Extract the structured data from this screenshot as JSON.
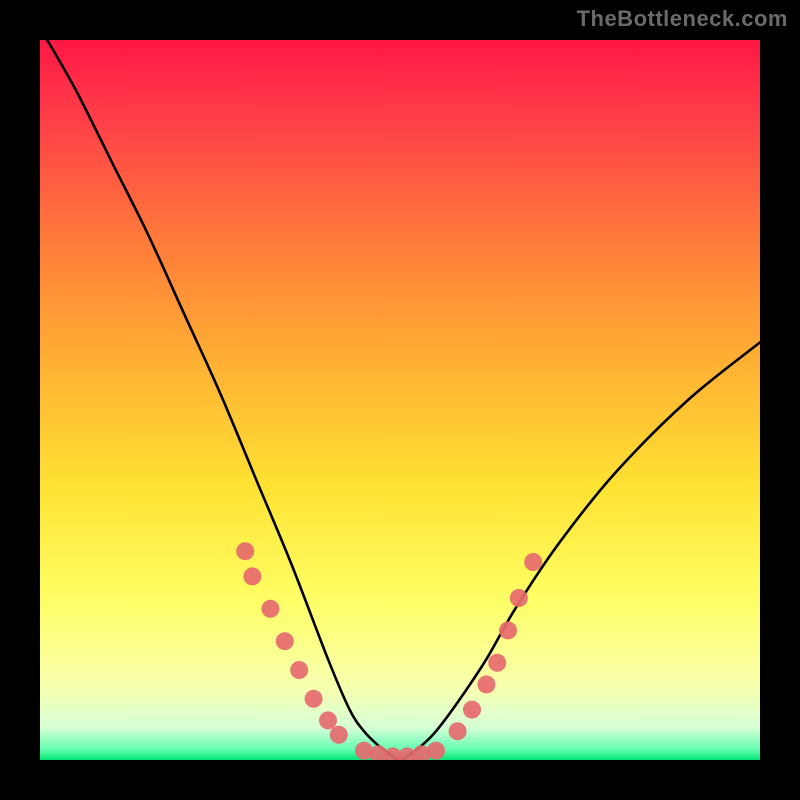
{
  "watermark": "TheBottleneck.com",
  "chart_data": {
    "type": "line",
    "title": "",
    "xlabel": "",
    "ylabel": "",
    "xlim": [
      0,
      100
    ],
    "ylim": [
      0,
      100
    ],
    "background_gradient": {
      "stops": [
        {
          "offset": 0.0,
          "color": "#ff1744"
        },
        {
          "offset": 0.1,
          "color": "#ff3b49"
        },
        {
          "offset": 0.28,
          "color": "#ff7b3a"
        },
        {
          "offset": 0.45,
          "color": "#ffb133"
        },
        {
          "offset": 0.62,
          "color": "#ffe233"
        },
        {
          "offset": 0.78,
          "color": "#ffff66"
        },
        {
          "offset": 0.9,
          "color": "#f7ffb0"
        },
        {
          "offset": 0.955,
          "color": "#d6ffd6"
        },
        {
          "offset": 0.985,
          "color": "#66ffb3"
        },
        {
          "offset": 1.0,
          "color": "#00e676"
        }
      ]
    },
    "series": [
      {
        "name": "bottleneck-curve",
        "x": [
          1,
          5,
          10,
          15,
          20,
          25,
          30,
          35,
          40,
          43,
          45,
          47,
          49,
          50,
          51,
          53,
          55,
          58,
          62,
          66,
          72,
          80,
          90,
          100
        ],
        "y": [
          100,
          93,
          83,
          73,
          62,
          51,
          39,
          27,
          14,
          7,
          4,
          2,
          0.5,
          0,
          0.5,
          2,
          4,
          8,
          14,
          21,
          30,
          40,
          50,
          58
        ]
      }
    ],
    "scatter_points": {
      "name": "highlighted-points",
      "color": "#e66a6f",
      "radius": 9,
      "points": [
        {
          "x": 28.5,
          "y": 29
        },
        {
          "x": 29.5,
          "y": 25.5
        },
        {
          "x": 32.0,
          "y": 21
        },
        {
          "x": 34.0,
          "y": 16.5
        },
        {
          "x": 36.0,
          "y": 12.5
        },
        {
          "x": 38.0,
          "y": 8.5
        },
        {
          "x": 40.0,
          "y": 5.5
        },
        {
          "x": 41.5,
          "y": 3.5
        },
        {
          "x": 45.0,
          "y": 1.3
        },
        {
          "x": 47.0,
          "y": 0.8
        },
        {
          "x": 49.0,
          "y": 0.5
        },
        {
          "x": 51.0,
          "y": 0.5
        },
        {
          "x": 53.0,
          "y": 0.8
        },
        {
          "x": 55.0,
          "y": 1.3
        },
        {
          "x": 58.0,
          "y": 4.0
        },
        {
          "x": 60.0,
          "y": 7.0
        },
        {
          "x": 62.0,
          "y": 10.5
        },
        {
          "x": 63.5,
          "y": 13.5
        },
        {
          "x": 65.0,
          "y": 18.0
        },
        {
          "x": 66.5,
          "y": 22.5
        },
        {
          "x": 68.5,
          "y": 27.5
        }
      ]
    }
  }
}
